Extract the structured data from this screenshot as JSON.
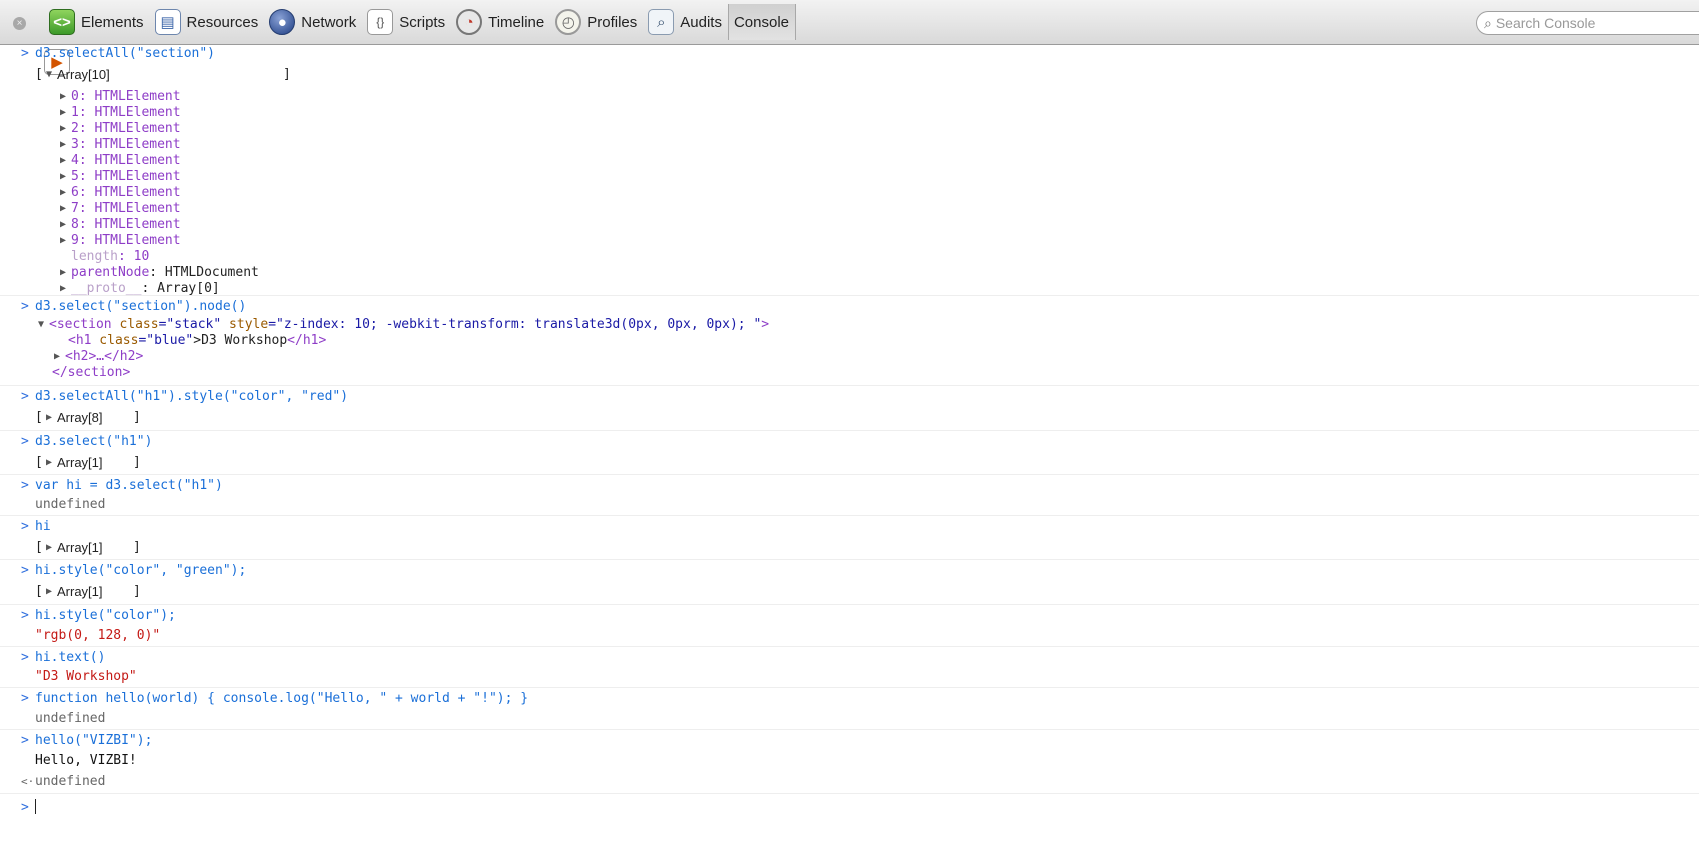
{
  "toolbar": {
    "close_label": "×",
    "tabs": [
      {
        "label": "Elements"
      },
      {
        "label": "Resources"
      },
      {
        "label": "Network"
      },
      {
        "label": "Scripts"
      },
      {
        "label": "Timeline"
      },
      {
        "label": "Profiles"
      },
      {
        "label": "Audits"
      },
      {
        "label": "Console"
      }
    ],
    "active_tab": "Console",
    "search_placeholder": "Search Console"
  },
  "console": {
    "prompt_glyph": ">",
    "result_glyph": "<·",
    "entries": [
      {
        "command": "d3.selectAll(\"section\")",
        "result_open": "[",
        "result_label": "Array[10]",
        "result_close": "]",
        "children": [
          "0: HTMLElement",
          "1: HTMLElement",
          "2: HTMLElement",
          "3: HTMLElement",
          "4: HTMLElement",
          "5: HTMLElement",
          "6: HTMLElement",
          "7: HTMLElement",
          "8: HTMLElement",
          "9: HTMLElement"
        ],
        "length_key": "length",
        "length_value": ": 10",
        "parent_key": "parentNode",
        "parent_value": ": HTMLDocument",
        "proto_key": "__proto__",
        "proto_value": ": Array[0]"
      },
      {
        "command": "d3.select(\"section\").node()",
        "node_open_tag": "<section",
        "node_attr1_name": " class",
        "node_attr1_value": "=\"stack\"",
        "node_attr2_name": " style",
        "node_attr2_value": "=\"z-index: 10; -webkit-transform: translate3d(0px, 0px, 0px); \"",
        "node_open_end": ">",
        "h1_open": "<h1",
        "h1_attr_name": " class",
        "h1_attr_value": "=\"blue\"",
        "h1_text": ">D3 Workshop",
        "h1_close": "</h1>",
        "h2_collapsed": "<h2>…</h2>",
        "node_close": "</section>"
      },
      {
        "command": "d3.selectAll(\"h1\").style(\"color\", \"red\")",
        "result_label": "Array[8]"
      },
      {
        "command": "d3.select(\"h1\")",
        "result_label": "Array[1]"
      },
      {
        "command": "var hi = d3.select(\"h1\")",
        "result_text": "undefined"
      },
      {
        "command": "hi",
        "result_label": "Array[1]"
      },
      {
        "command": "hi.style(\"color\", \"green\");",
        "result_label": "Array[1]"
      },
      {
        "command": "hi.style(\"color\");",
        "result_string": "\"rgb(0, 128, 0)\""
      },
      {
        "command": "hi.text()",
        "result_string": "\"D3 Workshop\""
      },
      {
        "command": "function hello(world) { console.log(\"Hello, \" + world + \"!\"); }",
        "result_text": "undefined"
      },
      {
        "command": "hello(\"VIZBI\");",
        "log_output": "Hello, VIZBI!",
        "result_text": "undefined"
      }
    ]
  }
}
